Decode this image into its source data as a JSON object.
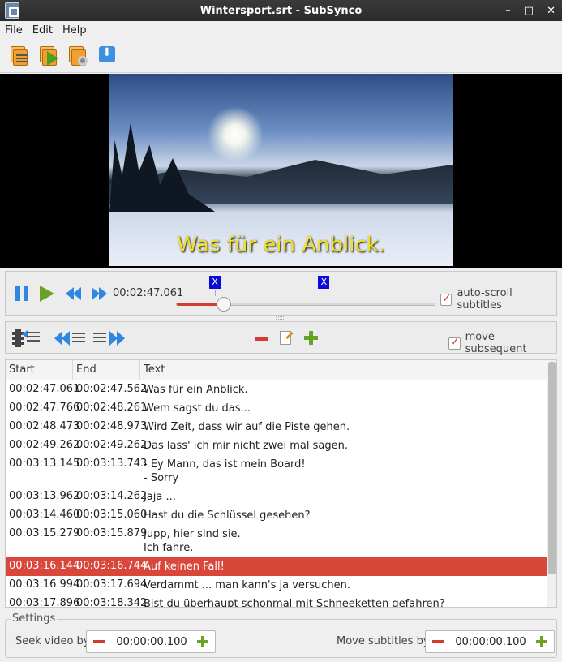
{
  "window": {
    "title": "Wintersport.srt - SubSynco",
    "min": "–",
    "max": "□",
    "close": "✕"
  },
  "menu": [
    "File",
    "Edit",
    "Help"
  ],
  "toolbar": [
    "open-subtitles",
    "open-video",
    "settings",
    "download"
  ],
  "video": {
    "subtitle": "Was für ein Anblick."
  },
  "playback": {
    "time": "00:02:47.061",
    "progress_percent": 18,
    "markers": [
      {
        "label": "X",
        "position_percent": 15
      },
      {
        "label": "X",
        "position_percent": 57
      }
    ],
    "autoscroll_label": "auto-scroll subtitles",
    "autoscroll_checked": true
  },
  "edit": {
    "move_subsequent_label": "move subsequent",
    "move_subsequent_checked": true
  },
  "table": {
    "columns": [
      "Start",
      "End",
      "Text"
    ],
    "rows": [
      {
        "start": "00:02:47.061",
        "end": "00:02:47.562",
        "text": "Was für ein Anblick."
      },
      {
        "start": "00:02:47.766",
        "end": "00:02:48.261",
        "text": "Wem sagst du das..."
      },
      {
        "start": "00:02:48.473",
        "end": "00:02:48.973",
        "text": "Wird Zeit, dass wir auf die Piste gehen."
      },
      {
        "start": "00:02:49.262",
        "end": "00:02:49.262",
        "text": "Das lass' ich mir nicht zwei mal sagen."
      },
      {
        "start": "00:03:13.145",
        "end": "00:03:13.743",
        "text": "- Ey Mann, das ist mein Board!\n- Sorry"
      },
      {
        "start": "00:03:13.962",
        "end": "00:03:14.262",
        "text": "Jaja ..."
      },
      {
        "start": "00:03:14.460",
        "end": "00:03:15.060",
        "text": "Hast du die Schlüssel gesehen?"
      },
      {
        "start": "00:03:15.279",
        "end": "00:03:15.879",
        "text": "Jupp, hier sind sie.\nIch fahre."
      },
      {
        "start": "00:03:16.144",
        "end": "00:03:16.744",
        "text": "Auf keinen Fall!",
        "selected": true
      },
      {
        "start": "00:03:16.994",
        "end": "00:03:17.694",
        "text": "Verdammt ... man kann's ja versuchen."
      },
      {
        "start": "00:03:17.896",
        "end": "00:03:18.342",
        "text": "Bist du überhaupt schonmal mit Schneeketten gefahren?"
      }
    ]
  },
  "settings": {
    "legend": "Settings",
    "seek_label": "Seek video by",
    "seek_value": "00:00:00.100",
    "move_label": "Move subtitles by",
    "move_value": "00:00:00.100"
  }
}
